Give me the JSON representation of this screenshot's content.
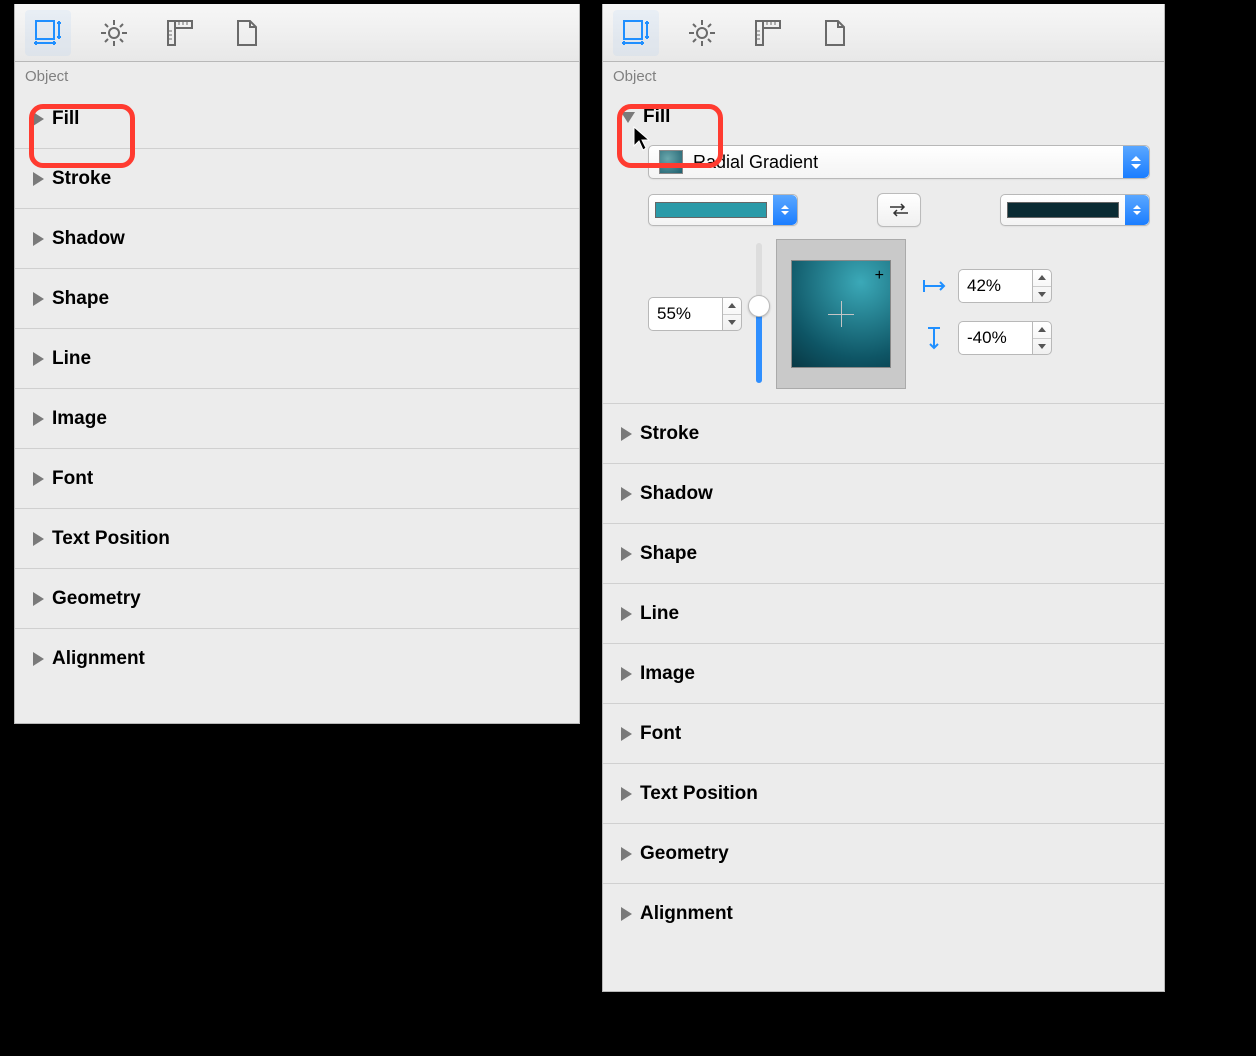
{
  "left": {
    "section": "Object",
    "rows": [
      "Fill",
      "Stroke",
      "Shadow",
      "Shape",
      "Line",
      "Image",
      "Font",
      "Text Position",
      "Geometry",
      "Alignment"
    ]
  },
  "right": {
    "section": "Object",
    "fill_label": "Fill",
    "dropdown": "Radial Gradient",
    "opacity": "55%",
    "posX": "42%",
    "posY": "-40%",
    "rows": [
      "Stroke",
      "Shadow",
      "Shape",
      "Line",
      "Image",
      "Font",
      "Text Position",
      "Geometry",
      "Alignment"
    ]
  }
}
